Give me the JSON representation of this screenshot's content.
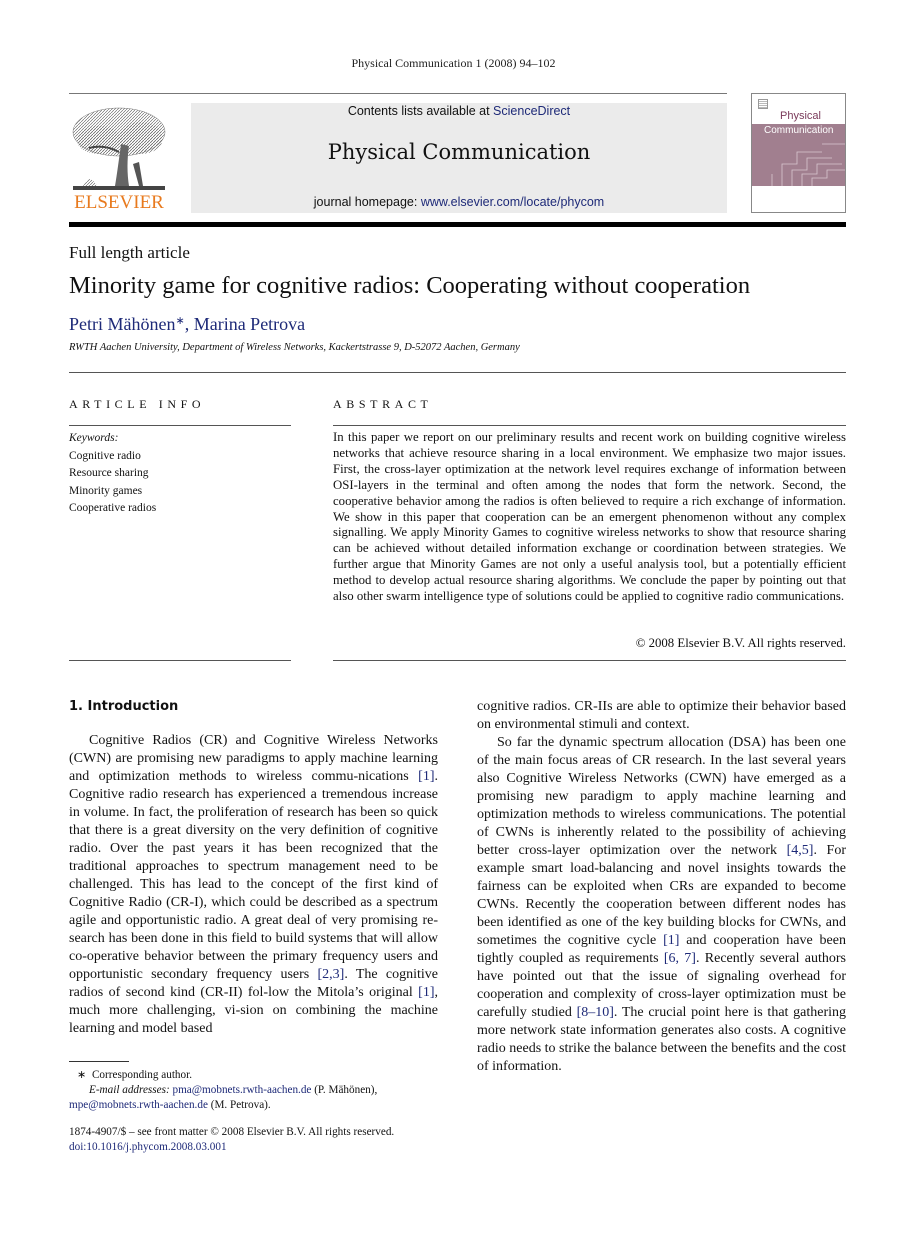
{
  "running_head": "Physical Communication 1 (2008) 94–102",
  "masthead": {
    "publisher_logo_text": "ELSEVIER",
    "contents_prefix": "Contents lists available at ",
    "contents_link": "ScienceDirect",
    "journal_name": "Physical Communication",
    "homepage_prefix": "journal homepage: ",
    "homepage_link": "www.elsevier.com/locate/phycom",
    "cover_title_line1": "Physical",
    "cover_title_line2": "Communication",
    "colors": {
      "publisher_orange": "#e87a1e",
      "link_blue": "#1e2a78",
      "cover_mauve": "#a17f8f",
      "masthead_gray": "#ebebeb"
    }
  },
  "article": {
    "type": "Full length article",
    "title": "Minority game for cognitive radios: Cooperating without cooperation",
    "authors": [
      {
        "name": "Petri Mähönen",
        "mark": "∗"
      },
      {
        "name": "Marina Petrova",
        "mark": ""
      }
    ],
    "author_separator": ", ",
    "affiliation": "RWTH Aachen University, Department of Wireless Networks, Kackertstrasse 9, D-52072 Aachen, Germany"
  },
  "article_info": {
    "label": "ARTICLE INFO",
    "keywords_label": "Keywords:",
    "keywords": [
      "Cognitive radio",
      "Resource sharing",
      "Minority games",
      "Cooperative radios"
    ]
  },
  "abstract": {
    "label": "ABSTRACT",
    "text": "In this paper we report on our preliminary results and recent work on building cognitive wireless networks that achieve resource sharing in a local environment. We emphasize two major issues. First, the cross-layer optimization at the network level requires exchange of information between OSI-layers in the terminal and often among the nodes that form the network. Second, the cooperative behavior among the radios is often believed to require a rich exchange of information. We show in this paper that cooperation can be an emergent phenomenon without any complex signalling. We apply Minority Games to cognitive wireless networks to show that resource sharing can be achieved without detailed information exchange or coordination between strategies. We further argue that Minority Games are not only a useful analysis tool, but a potentially efficient method to develop actual resource sharing algorithms. We conclude the paper by pointing out that also other swarm intelligence type of solutions could be applied to cognitive radio communications.",
    "copyright": "© 2008 Elsevier B.V. All rights reserved."
  },
  "section1": {
    "heading": "1.  Introduction",
    "left_column": [
      {
        "t": "Cognitive Radios (CR) and Cognitive Wireless Networks (CWN)  are promising new paradigms to apply machine learning and optimization methods to wireless commu-nications "
      },
      {
        "ref": "[1]"
      },
      {
        "t": ". Cognitive radio research has experienced a tremendous increase in volume. In fact, the proliferation of research has been so quick that there is a great diversity on the very definition of cognitive radio. Over the past years it has been recognized that the traditional approaches to spectrum management need to be challenged. This has lead to the concept of the first kind of Cognitive Radio (CR-I), which could be described as a spectrum agile and opportunistic radio. A great deal of very promising re-search has been done in this field to build systems that will allow co-operative behavior between the primary frequency users and opportunistic secondary frequency users "
      },
      {
        "ref": "[2,3]"
      },
      {
        "t": ". The cognitive radios of second kind (CR-II) fol-low the Mitola’s original "
      },
      {
        "ref": "[1]"
      },
      {
        "t": ", much more challenging, vi-sion on combining the machine learning and model based"
      }
    ],
    "right_column_p1": "cognitive radios. CR-IIs are able to optimize their behavior based on environmental stimuli and context.",
    "right_column_p2": [
      {
        "t": "So far the dynamic spectrum allocation (DSA) has been one of the main focus areas of CR research. In the last several years also Cognitive Wireless Networks (CWN) have emerged as a promising new paradigm to apply machine learning and optimization methods to wireless communications. The potential of CWNs is inherently related to the possibility of achieving better cross-layer optimization over the network "
      },
      {
        "ref": "[4,5]"
      },
      {
        "t": ". For example smart load-balancing and novel insights towards the fairness can be exploited when CRs are expanded to become CWNs. Recently the cooperation between different nodes has been identified as one of the key building blocks for CWNs, and sometimes the cognitive cycle "
      },
      {
        "ref": "[1]"
      },
      {
        "t": " and cooperation have been tightly coupled as requirements "
      },
      {
        "ref": "[6, 7]"
      },
      {
        "t": ". Recently several authors have pointed out that the issue of signaling overhead for cooperation and complexity of cross-layer optimization must be carefully studied "
      },
      {
        "ref": "[8–10]"
      },
      {
        "t": ". The crucial point here is that gathering more network state information generates also costs. A cognitive radio needs to strike the balance between the benefits and the cost of information."
      }
    ]
  },
  "footnotes": {
    "mark": "∗",
    "corresponding": "Corresponding author.",
    "email_label": "E-mail addresses:",
    "emails": [
      {
        "address": "pma@mobnets.rwth-aachen.de",
        "owner": " (P. Mähönen),"
      },
      {
        "address": "mpe@mobnets.rwth-aachen.de",
        "owner": " (M. Petrova)."
      }
    ]
  },
  "front_matter": {
    "issn_line": "1874-4907/$ – see front matter © 2008 Elsevier B.V. All rights reserved.",
    "doi": "doi:10.1016/j.phycom.2008.03.001"
  }
}
